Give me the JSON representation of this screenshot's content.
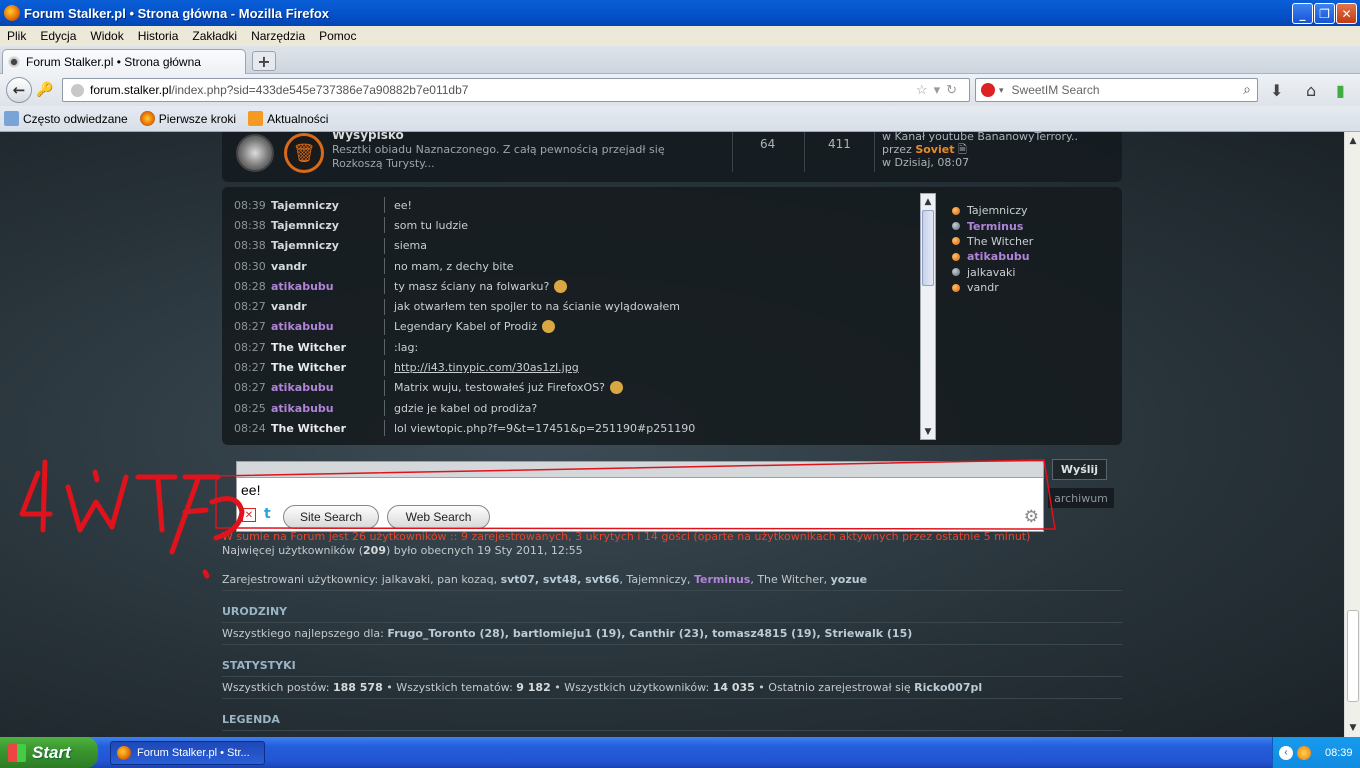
{
  "window": {
    "title": "Forum Stalker.pl • Strona główna - Mozilla Firefox"
  },
  "menu": [
    "Plik",
    "Edycja",
    "Widok",
    "Historia",
    "Zakładki",
    "Narzędzia",
    "Pomoc"
  ],
  "tab": {
    "title": "Forum Stalker.pl • Strona główna",
    "new_tab_label": "+"
  },
  "urlbar": {
    "domain": "forum.stalker.pl",
    "path": "/index.php?sid=433de545e737386e7a90882b7e011db7"
  },
  "searchbar": {
    "placeholder": "SweetIM Search"
  },
  "bookmarks": [
    "Często odwiedzane",
    "Pierwsze kroki",
    "Aktualności"
  ],
  "forum_row": {
    "name": "Wysypisko",
    "description": "Resztki obiadu Naznaczonego. Z całą pewnością przejadł się Rozkoszą Turysty...",
    "topics": "64",
    "posts": "411",
    "last_post_line1": "w Kanał youtube BananowyTerrory..",
    "last_post_by_label": "przez",
    "last_post_author": "Soviet",
    "last_post_date": "w Dzisiaj, 08:07"
  },
  "chat": {
    "messages": [
      {
        "time": "08:39",
        "user": "Tajemniczy",
        "style": "normal",
        "text": "ee!",
        "smiley": false,
        "link": false
      },
      {
        "time": "08:38",
        "user": "Tajemniczy",
        "style": "normal",
        "text": "som tu ludzie",
        "smiley": false,
        "link": false
      },
      {
        "time": "08:38",
        "user": "Tajemniczy",
        "style": "normal",
        "text": "siema",
        "smiley": false,
        "link": false
      },
      {
        "time": "08:30",
        "user": "vandr",
        "style": "normal",
        "text": "no mam, z dechy bite",
        "smiley": false,
        "link": false
      },
      {
        "time": "08:28",
        "user": "atikabubu",
        "style": "purple",
        "text": "ty masz ściany na folwarku?",
        "smiley": true,
        "link": false
      },
      {
        "time": "08:27",
        "user": "vandr",
        "style": "normal",
        "text": "jak otwarłem ten spojler to na ścianie wylądowałem",
        "smiley": false,
        "link": false
      },
      {
        "time": "08:27",
        "user": "atikabubu",
        "style": "purple",
        "text": "Legendary Kabel of Prodiż",
        "smiley": true,
        "link": false
      },
      {
        "time": "08:27",
        "user": "The Witcher",
        "style": "white",
        "text": ":lag:",
        "smiley": false,
        "link": false
      },
      {
        "time": "08:27",
        "user": "The Witcher",
        "style": "white",
        "text": "http://i43.tinypic.com/30as1zl.jpg",
        "smiley": false,
        "link": true
      },
      {
        "time": "08:27",
        "user": "atikabubu",
        "style": "purple",
        "text": "Matrix wuju, testowałeś już FirefoxOS?",
        "smiley": true,
        "link": false
      },
      {
        "time": "08:25",
        "user": "atikabubu",
        "style": "purple",
        "text": "gdzie je kabel od prodiża?",
        "smiley": false,
        "link": false
      },
      {
        "time": "08:24",
        "user": "The Witcher",
        "style": "white",
        "text": "lol viewtopic.php?f=9&t=17451&p=251190#p251190",
        "smiley": false,
        "link": false
      }
    ],
    "online": [
      {
        "name": "Tajemniczy",
        "dot": "o",
        "style": "normal"
      },
      {
        "name": "Terminus",
        "dot": "g",
        "style": "purple"
      },
      {
        "name": "The Witcher",
        "dot": "o",
        "style": "normal"
      },
      {
        "name": "atikabubu",
        "dot": "o",
        "style": "purple"
      },
      {
        "name": "jalkavaki",
        "dot": "g",
        "style": "normal"
      },
      {
        "name": "vandr",
        "dot": "o",
        "style": "normal"
      }
    ],
    "send_label": "Wyślij",
    "archive_label": "archiwum"
  },
  "search_popup": {
    "query": "ee!",
    "site_search_label": "Site Search",
    "web_search_label": "Web Search"
  },
  "stats": {
    "online_line": "W sumie na Forum jest 26 użytkowników :: 9 zarejestrowanych, 3 ukrytych i 14 gości (oparte na użytkownikach aktywnych przez ostatnie 5 minut)",
    "most_line_prefix": "Najwięcej użytkowników (",
    "most_count": "209",
    "most_line_suffix": ") było obecnych 19 Sty 2011, 12:55",
    "registered_label": "Zarejestrowani użytkownicy: jalkavaki, pan kozaq, ",
    "registered_bold": "svt07, svt48, svt66",
    "registered_mid": ", Tajemniczy, ",
    "registered_purple": "Terminus",
    "registered_mid2": ", The Witcher, ",
    "registered_last": "yozue",
    "birthdays_header": "URODZINY",
    "birthdays_prefix": "Wszystkiego najlepszego dla: ",
    "birthdays": "Frugo_Toronto (28), bartlomieju1 (19), Canthir (23), tomasz4815 (19), Striewalk (15)",
    "stats_header": "STATYSTYKI",
    "posts_label": "Wszystkich postów: ",
    "posts_value": "188 578",
    "topics_label": " • Wszystkich tematów: ",
    "topics_value": "9 182",
    "users_label": " • Wszystkich użytkowników: ",
    "users_value": "14 035",
    "newest_label": " • Ostatnio zarejestrował się ",
    "newest_user": "Ricko007pl",
    "legend_header": "LEGENDA"
  },
  "annotation": {
    "text": "WTF?",
    "color": "#e0121b"
  },
  "taskbar": {
    "start_label": "Start",
    "task_item": "Forum Stalker.pl • Str...",
    "clock": "08:39"
  }
}
